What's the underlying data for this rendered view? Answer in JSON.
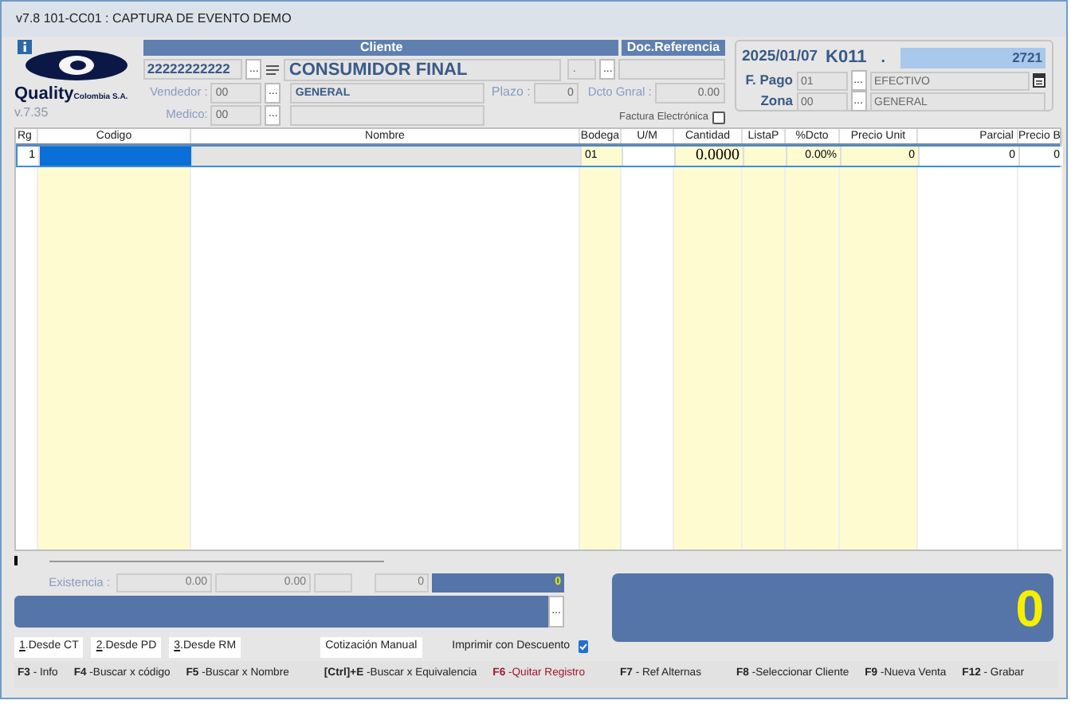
{
  "window": {
    "title": "v7.8 101-CC01 : CAPTURA DE EVENTO DEMO"
  },
  "logo": {
    "brand": "Quality",
    "sub": "Colombia S.A.",
    "version": "v.7.35"
  },
  "cliente": {
    "header": "Cliente",
    "doc_header": "Doc.Referencia",
    "code": "22222222222",
    "code_button": "...",
    "ref_button": "...",
    "vendedor_button": "...",
    "medico_button": "...",
    "name": "CONSUMIDOR FINAL",
    "ref_value": ".",
    "vendedor_label": "Vendedor :",
    "vendedor": "00",
    "vendedor_name": "GENERAL",
    "plazo_label": "Plazo :",
    "plazo": "0",
    "dcto_label": "Dcto Gnral :",
    "dcto": "0.00",
    "medico_label": "Medico:",
    "medico": "00",
    "factura_label": "Factura Electrónica",
    "factura_checked": false
  },
  "documento": {
    "fpago_button": "...",
    "zona_button": "...",
    "date": "2025/01/07",
    "code": "K011",
    "dot": ".",
    "number": "2721",
    "fpago_label": "F. Pago",
    "fpago": "01",
    "fpago_name": "EFECTIVO",
    "zona_label": "Zona",
    "zona": "00",
    "zona_name": "GENERAL"
  },
  "table": {
    "columns": [
      {
        "label": "Rg",
        "highlight": false
      },
      {
        "label": "Codigo",
        "highlight": true
      },
      {
        "label": "Nombre",
        "highlight": false
      },
      {
        "label": "Bodega",
        "highlight": true
      },
      {
        "label": "U/M",
        "highlight": false
      },
      {
        "label": "Cantidad",
        "highlight": true
      },
      {
        "label": "ListaP",
        "highlight": true
      },
      {
        "label": "%Dcto",
        "highlight": true
      },
      {
        "label": "Precio Unit",
        "highlight": true
      },
      {
        "label": "Parcial",
        "highlight": false
      },
      {
        "label": "Precio B",
        "highlight": false
      }
    ],
    "rows": [
      {
        "selected": true,
        "cells": {
          "0": "1",
          "3": "01",
          "5": "0.0000",
          "7": "0.00%",
          "8": "0",
          "9": "0",
          "10": "0"
        }
      }
    ]
  },
  "existencia": {
    "label": "Existencia :",
    "values": [
      "0.00",
      "0.00",
      "0"
    ],
    "blue_value": "0"
  },
  "description_button": "...",
  "total": "0",
  "buttons": [
    {
      "key": "1",
      "label": ".Desde CT"
    },
    {
      "key": "2",
      "label": ".Desde PD"
    },
    {
      "key": "3",
      "label": ".Desde RM"
    }
  ],
  "cotizacion": "Cotización Manual",
  "imprimir": {
    "label": "Imprimir con Descuento",
    "checked": true
  },
  "shortcuts": [
    {
      "key": "F3",
      "label": "- Info",
      "color": "#222222"
    },
    {
      "key": "F4",
      "label": "-Buscar x código",
      "color": "#222222"
    },
    {
      "key": "F5",
      "label": "-Buscar x Nombre",
      "color": "#222222"
    },
    {
      "key": "[Ctrl]+E",
      "label": "-Buscar x Equivalencia",
      "color": "#222222"
    },
    {
      "key": "F6",
      "label": "-Quitar Registro",
      "color": "#a0182a"
    },
    {
      "key": "F7",
      "label": "- Ref Alternas",
      "color": "#222222"
    },
    {
      "key": "F8",
      "label": "-Seleccionar Cliente",
      "color": "#222222"
    },
    {
      "key": "F9",
      "label": "-Nueva Venta",
      "color": "#222222"
    },
    {
      "key": "F12",
      "label": "- Grabar",
      "color": "#222222"
    }
  ]
}
